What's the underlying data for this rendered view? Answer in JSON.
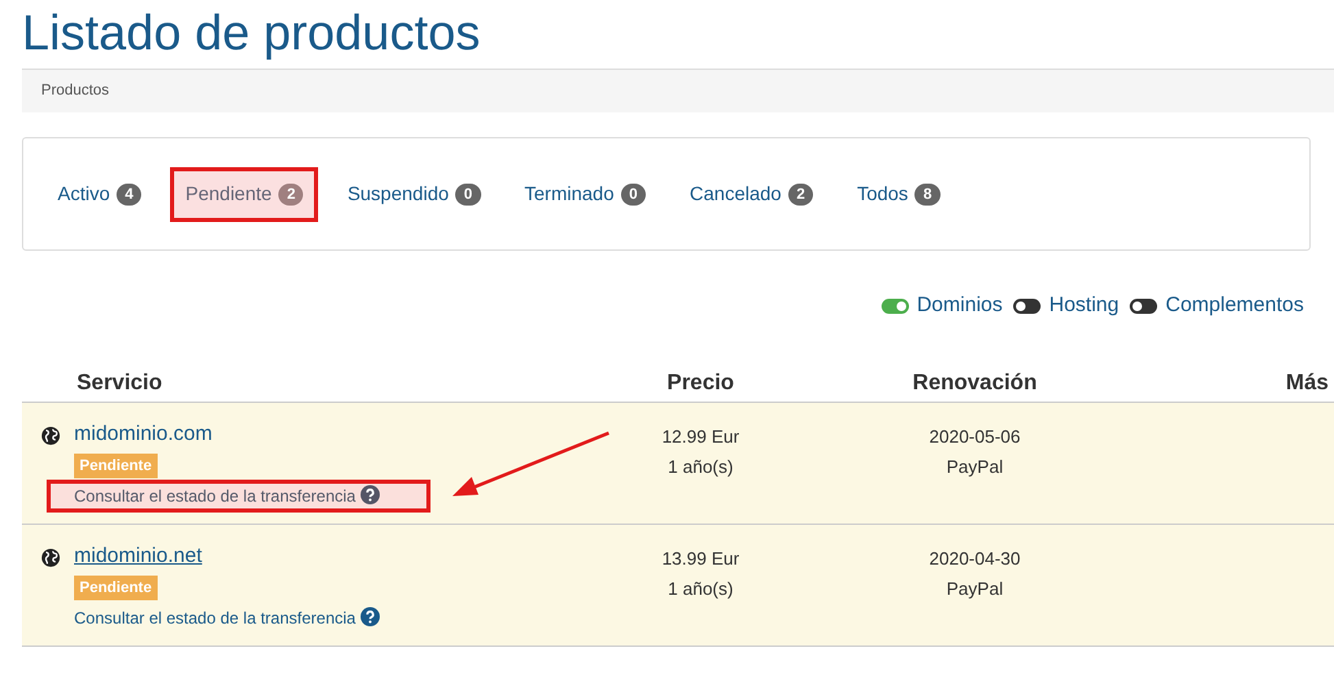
{
  "page_title": "Listado de productos",
  "breadcrumb": "Productos",
  "tabs": [
    {
      "label": "Activo",
      "count": "4",
      "selected": false
    },
    {
      "label": "Pendiente",
      "count": "2",
      "selected": true
    },
    {
      "label": "Suspendido",
      "count": "0",
      "selected": false
    },
    {
      "label": "Terminado",
      "count": "0",
      "selected": false
    },
    {
      "label": "Cancelado",
      "count": "2",
      "selected": false
    },
    {
      "label": "Todos",
      "count": "8",
      "selected": false
    }
  ],
  "filters": [
    {
      "label": "Dominios",
      "on": true
    },
    {
      "label": "Hosting",
      "on": false
    },
    {
      "label": "Complementos",
      "on": false
    }
  ],
  "table": {
    "columns": [
      "Servicio",
      "Precio",
      "Renovación",
      "Más"
    ],
    "rows": [
      {
        "domain": "midominio.com",
        "underlined": false,
        "status": "Pendiente",
        "link": "Consultar el estado de la transferencia",
        "highlighted": true,
        "price": "12.99 Eur",
        "period": "1 año(s)",
        "renewal": "2020-05-06",
        "payment": "PayPal"
      },
      {
        "domain": "midominio.net",
        "underlined": true,
        "status": "Pendiente",
        "link": "Consultar el estado de la transferencia",
        "highlighted": false,
        "price": "13.99 Eur",
        "period": "1 año(s)",
        "renewal": "2020-04-30",
        "payment": "PayPal"
      }
    ]
  }
}
